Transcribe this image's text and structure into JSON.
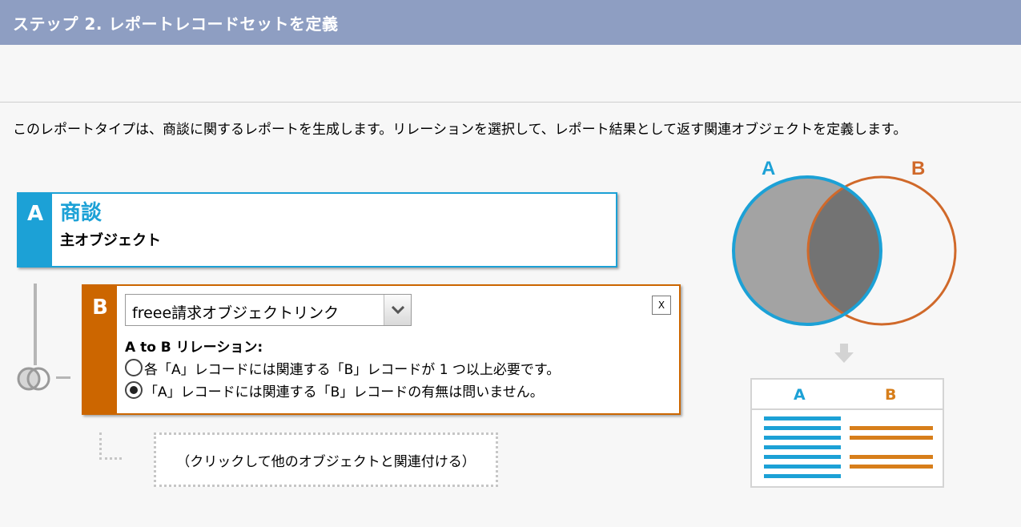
{
  "header": {
    "title": "ステップ 2. レポートレコードセットを定義"
  },
  "description": "このレポートタイプは、商談に関するレポートを生成します。リレーションを選択して、レポート結果として返す関連オブジェクトを定義します。",
  "object_a": {
    "badge": "A",
    "name": "商談",
    "subtitle": "主オブジェクト"
  },
  "object_b": {
    "badge": "B",
    "selected_object": "freee請求オブジェクトリンク",
    "close_label": "X",
    "relation_label": "A to B リレーション:",
    "options": [
      {
        "label": "各「A」レコードには関連する「B」レコードが 1 つ以上必要です。",
        "checked": false
      },
      {
        "label": "「A」レコードには関連する「B」レコードの有無は問いません。",
        "checked": true
      }
    ]
  },
  "add_related": {
    "label": "（クリックして他のオブジェクトと関連付ける）"
  },
  "diagram": {
    "label_a": "A",
    "label_b": "B",
    "table_header_a": "A",
    "table_header_b": "B",
    "color_a": "#1ca1d6",
    "color_b": "#d77e1a"
  },
  "colors": {
    "header_bg": "#8e9ec2",
    "accent_a": "#1ca1d6",
    "accent_b": "#cc6600"
  },
  "icons": {
    "join": "join-circles-icon",
    "dropdown": "chevron-down-icon",
    "close": "close-icon",
    "arrow": "arrow-down-icon"
  }
}
